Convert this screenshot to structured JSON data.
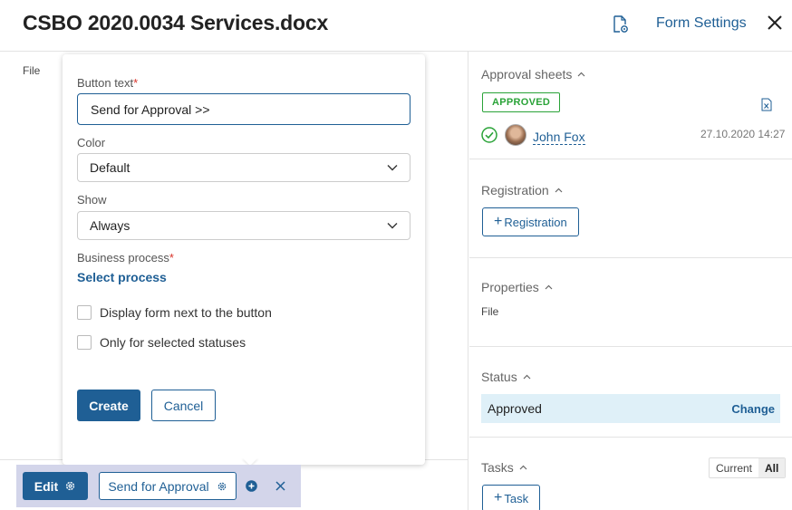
{
  "header": {
    "title": "CSBO 2020.0034 Services.docx",
    "form_settings_label": "Form Settings"
  },
  "left": {
    "file_label": "File"
  },
  "popup": {
    "button_text_label": "Button text",
    "button_text_value": "Send for Approval >>",
    "color_label": "Color",
    "color_value": "Default",
    "show_label": "Show",
    "show_value": "Always",
    "business_process_label": "Business process",
    "select_process_link": "Select process",
    "checkbox_display_form": "Display form next to the button",
    "checkbox_selected_statuses": "Only for selected statuses",
    "create_label": "Create",
    "cancel_label": "Cancel",
    "required_mark": "*"
  },
  "toolbar": {
    "edit_label": "Edit",
    "send_label": "Send for Approval"
  },
  "right": {
    "approval": {
      "title": "Approval sheets",
      "badge": "APPROVED",
      "user": "John Fox",
      "date": "27.10.2020 14:27"
    },
    "registration": {
      "title": "Registration",
      "button": "Registration"
    },
    "properties": {
      "title": "Properties",
      "file": "File"
    },
    "status": {
      "title": "Status",
      "value": "Approved",
      "change_label": "Change"
    },
    "tasks": {
      "title": "Tasks",
      "toggle_current": "Current",
      "toggle_all": "All",
      "button": "Task"
    }
  },
  "colors": {
    "primary": "#1f5f95",
    "approved_green": "#2aa338",
    "required_red": "#d9342b",
    "toolbar_bg": "#d3d5ea",
    "status_bg": "#dff0f8"
  }
}
